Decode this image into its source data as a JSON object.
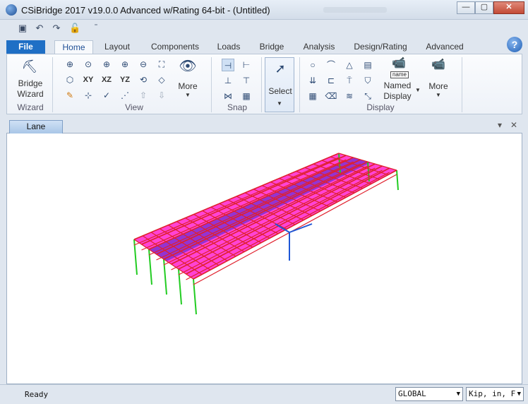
{
  "window": {
    "title": "CSiBridge 2017 v19.0.0 Advanced w/Rating 64-bit - (Untitled)",
    "minimize_glyph": "—",
    "maximize_glyph": "▢",
    "close_glyph": "✕"
  },
  "qat": {
    "dropdown_glyph": "⁼"
  },
  "tabs": {
    "file": "File",
    "items": [
      "Home",
      "Layout",
      "Components",
      "Loads",
      "Bridge",
      "Analysis",
      "Design/Rating",
      "Advanced"
    ]
  },
  "help_glyph": "?",
  "ribbon": {
    "bridge_wizard": {
      "line1": "Bridge",
      "line2": "Wizard",
      "group": "Wizard"
    },
    "view": {
      "group": "View",
      "plane_xy": "XY",
      "plane_xz": "XZ",
      "plane_yz": "YZ",
      "more": "More"
    },
    "snap": {
      "group": "Snap"
    },
    "select": {
      "label": "Select"
    },
    "display": {
      "group": "Display",
      "named_badge": "name",
      "named_line1": "Named",
      "named_line2": "Display",
      "more": "More"
    }
  },
  "document": {
    "tab": "Lane",
    "dropdown_glyph": "▾",
    "close_glyph": "✕"
  },
  "status": {
    "text": "Ready",
    "coord_system": "GLOBAL",
    "units": "Kip, in, F"
  },
  "colors": {
    "frame_red": "#e0202c",
    "deck_magenta": "#ff22cc",
    "lane_purple": "#7a2fd0",
    "support_green": "#22cc22",
    "axis_blue": "#1f57d6"
  }
}
